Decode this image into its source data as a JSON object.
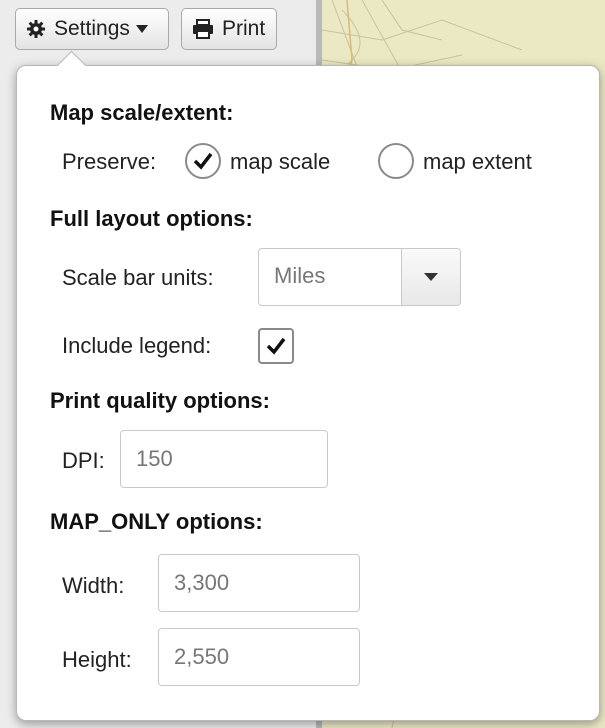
{
  "toolbar": {
    "settings_label": "Settings",
    "print_label": "Print"
  },
  "popup": {
    "scale_section": {
      "title": "Map scale/extent:",
      "preserve_label": "Preserve:",
      "options": [
        {
          "label": "map scale",
          "selected": true
        },
        {
          "label": "map extent",
          "selected": false
        }
      ]
    },
    "layout_section": {
      "title": "Full layout options:",
      "scale_units_label": "Scale bar units:",
      "scale_units_value": "Miles",
      "legend_label": "Include legend:",
      "legend_checked": true
    },
    "quality_section": {
      "title": "Print quality options:",
      "dpi_label": "DPI:",
      "dpi_value": "150"
    },
    "maponly_section": {
      "title": "MAP_ONLY options:",
      "width_label": "Width:",
      "width_value": "3,300",
      "height_label": "Height:",
      "height_value": "2,550"
    }
  },
  "colors": {
    "map_background": "#ebe8c4",
    "popup_background": "#ffffff"
  }
}
